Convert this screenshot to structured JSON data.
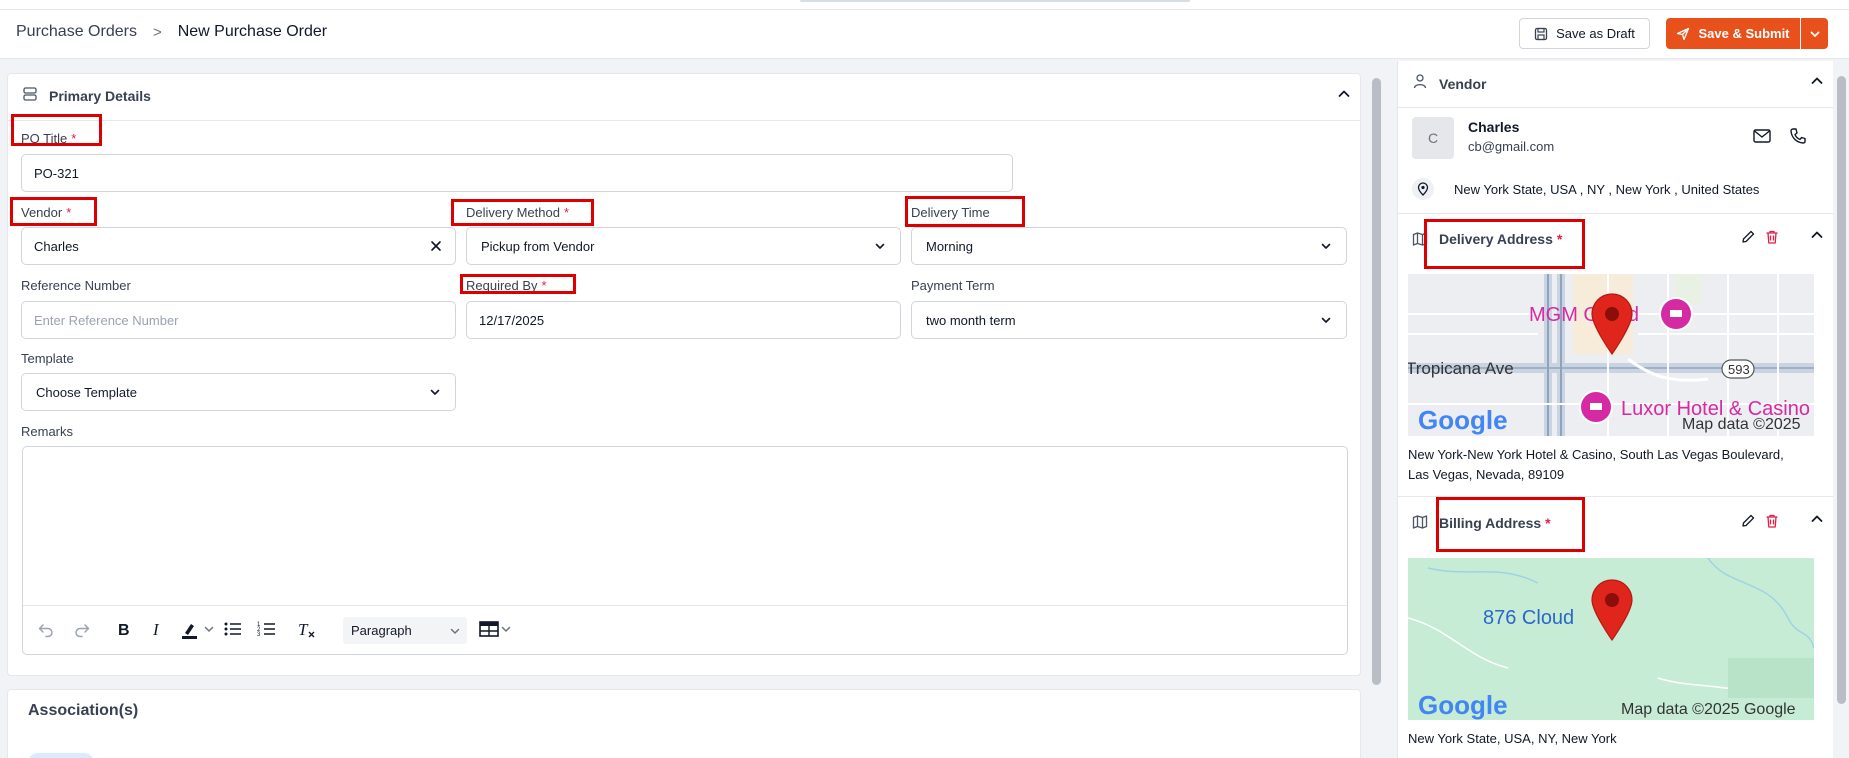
{
  "breadcrumb": {
    "parent": "Purchase Orders",
    "separator": ">",
    "current": "New Purchase Order"
  },
  "actions": {
    "save_draft": "Save as Draft",
    "save_submit": "Save & Submit"
  },
  "primary_details": {
    "title": "Primary Details",
    "po_title": {
      "label": "PO Title",
      "value": "PO-321"
    },
    "vendor": {
      "label": "Vendor",
      "value": "Charles"
    },
    "delivery_method": {
      "label": "Delivery Method",
      "value": "Pickup from Vendor"
    },
    "delivery_time": {
      "label": "Delivery Time",
      "value": "Morning"
    },
    "reference_number": {
      "label": "Reference Number",
      "placeholder": "Enter Reference Number"
    },
    "required_by": {
      "label": "Required By",
      "value": "12/17/2025"
    },
    "payment_term": {
      "label": "Payment Term",
      "value": "two month term"
    },
    "template": {
      "label": "Template",
      "value": "Choose Template"
    },
    "remarks": {
      "label": "Remarks",
      "paragraph_style": "Paragraph"
    }
  },
  "associations": {
    "title": "Association(s)"
  },
  "vendor_panel": {
    "title": "Vendor",
    "avatar_initial": "C",
    "name": "Charles",
    "email": "cb@gmail.com",
    "location": "New York State, USA , NY , New York , United States"
  },
  "delivery_address": {
    "title": "Delivery Address",
    "map_labels": [
      "MGM Grand",
      "Tropicana Ave",
      "593",
      "Luxor Hotel & Casino"
    ],
    "map_attribution": "Map data ©2025",
    "google": "Google",
    "address_line1": "New York-New York Hotel & Casino, South Las Vegas Boulevard,",
    "address_line2": "Las Vegas, Nevada, 89109"
  },
  "billing_address": {
    "title": "Billing Address",
    "map_label": "876 Cloud",
    "map_attribution": "Map data ©2025 Google",
    "google": "Google",
    "address": "New York State, USA, NY, New York"
  },
  "colors": {
    "accent": "#e8501c",
    "required": "#e11d48",
    "highlight": "#dc0000",
    "delete": "#e11d48"
  }
}
